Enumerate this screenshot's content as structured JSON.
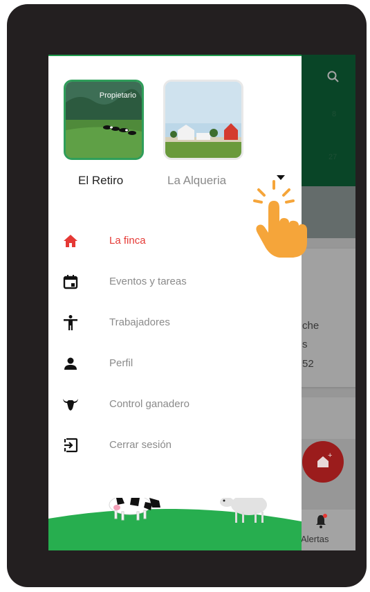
{
  "colors": {
    "accent_green": "#1f9a4c",
    "active_red": "#e53935",
    "hand_orange": "#f5a53a"
  },
  "farms": [
    {
      "name": "El Retiro",
      "badge": "Propietario",
      "selected": true
    },
    {
      "name": "La Alqueria",
      "selected": false
    }
  ],
  "menu": [
    {
      "label": "La finca",
      "icon": "home-icon",
      "active": true
    },
    {
      "label": "Eventos y tareas",
      "icon": "calendar-icon",
      "active": false
    },
    {
      "label": "Trabajadores",
      "icon": "person-icon",
      "active": false
    },
    {
      "label": "Perfil",
      "icon": "profile-icon",
      "active": false
    },
    {
      "label": "Control ganadero",
      "icon": "cow-head-icon",
      "active": false
    },
    {
      "label": "Cerrar sesión",
      "icon": "logout-icon",
      "active": false
    }
  ],
  "background_app": {
    "header_numbers": [
      "8",
      "27"
    ],
    "card_lines": [
      "che",
      "s",
      "52"
    ],
    "bottom_nav": {
      "alerts_label": "Alertas"
    }
  }
}
